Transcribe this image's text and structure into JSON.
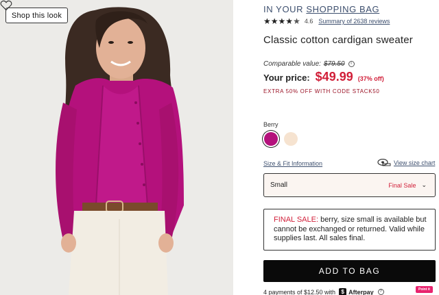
{
  "photo": {
    "shop_look_label": "Shop this look",
    "wishlist_icon": "heart-icon"
  },
  "header": {
    "prefix": "IN YOUR",
    "bag_link": "SHOPPING BAG"
  },
  "rating": {
    "stars": 4.6,
    "value": "4.6",
    "reviews_link": "Summary of 2638 reviews"
  },
  "product": {
    "title": "Classic cotton cardigan sweater",
    "comparable_label": "Comparable value:",
    "comparable_price": "$79.50",
    "your_price_label": "Your price:",
    "price": "$49.99",
    "discount": "(37% off)",
    "promo": "EXTRA 50% OFF WITH CODE STACK50"
  },
  "color": {
    "label": "Berry",
    "swatches": [
      {
        "name": "Berry",
        "hex": "#b4117c",
        "selected": true
      },
      {
        "name": "Cream",
        "hex": "#f6e3d0",
        "selected": false
      }
    ]
  },
  "size": {
    "fit_link": "Size & Fit Information",
    "chart_link": "View size chart",
    "selected": "Small",
    "status": "Final Sale"
  },
  "notice": {
    "label": "FINAL SALE:",
    "text": " berry, size small is available but cannot be exchanged or returned. Valid while supplies last. All sales final."
  },
  "cta": {
    "add_to_bag": "ADD TO BAG"
  },
  "payment": {
    "text": "4 payments of $12.50 with",
    "provider": "Afterpay",
    "badge": "Point it like"
  },
  "colors": {
    "sale_red": "#d11e38",
    "link_navy": "#3d4f6e",
    "berry": "#b4117c",
    "button_black": "#0a0a0a"
  }
}
